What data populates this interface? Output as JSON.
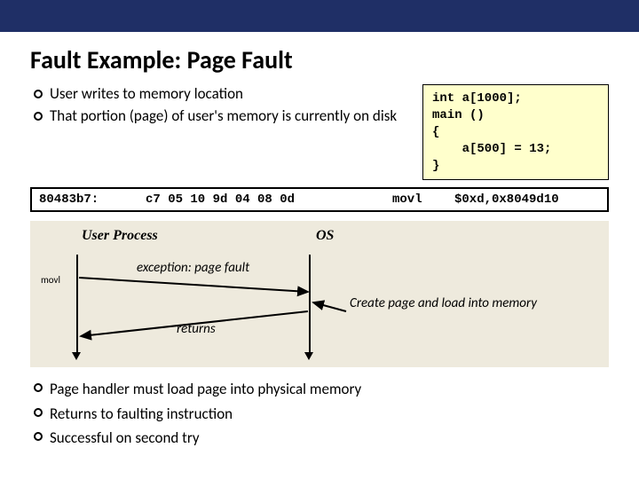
{
  "title": "Fault Example: Page Fault",
  "bullets_top": [
    "User writes to memory location",
    "That portion (page) of user's memory is currently on disk"
  ],
  "code": "int a[1000];\nmain ()\n{\n    a[500] = 13;\n}",
  "asm": {
    "addr": "80483b7:",
    "bytes": "c7 05 10 9d 04 08 0d",
    "mnemonic": "movl",
    "args": "$0xd,0x8049d10"
  },
  "diagram": {
    "user_label": "User Process",
    "os_label": "OS",
    "instr": "movl",
    "exception": "exception: page fault",
    "returns": "returns",
    "action": "Create page and load into memory"
  },
  "bullets_bottom": [
    "Page handler must load page into physical memory",
    "Returns to faulting instruction",
    "Successful on second try"
  ]
}
